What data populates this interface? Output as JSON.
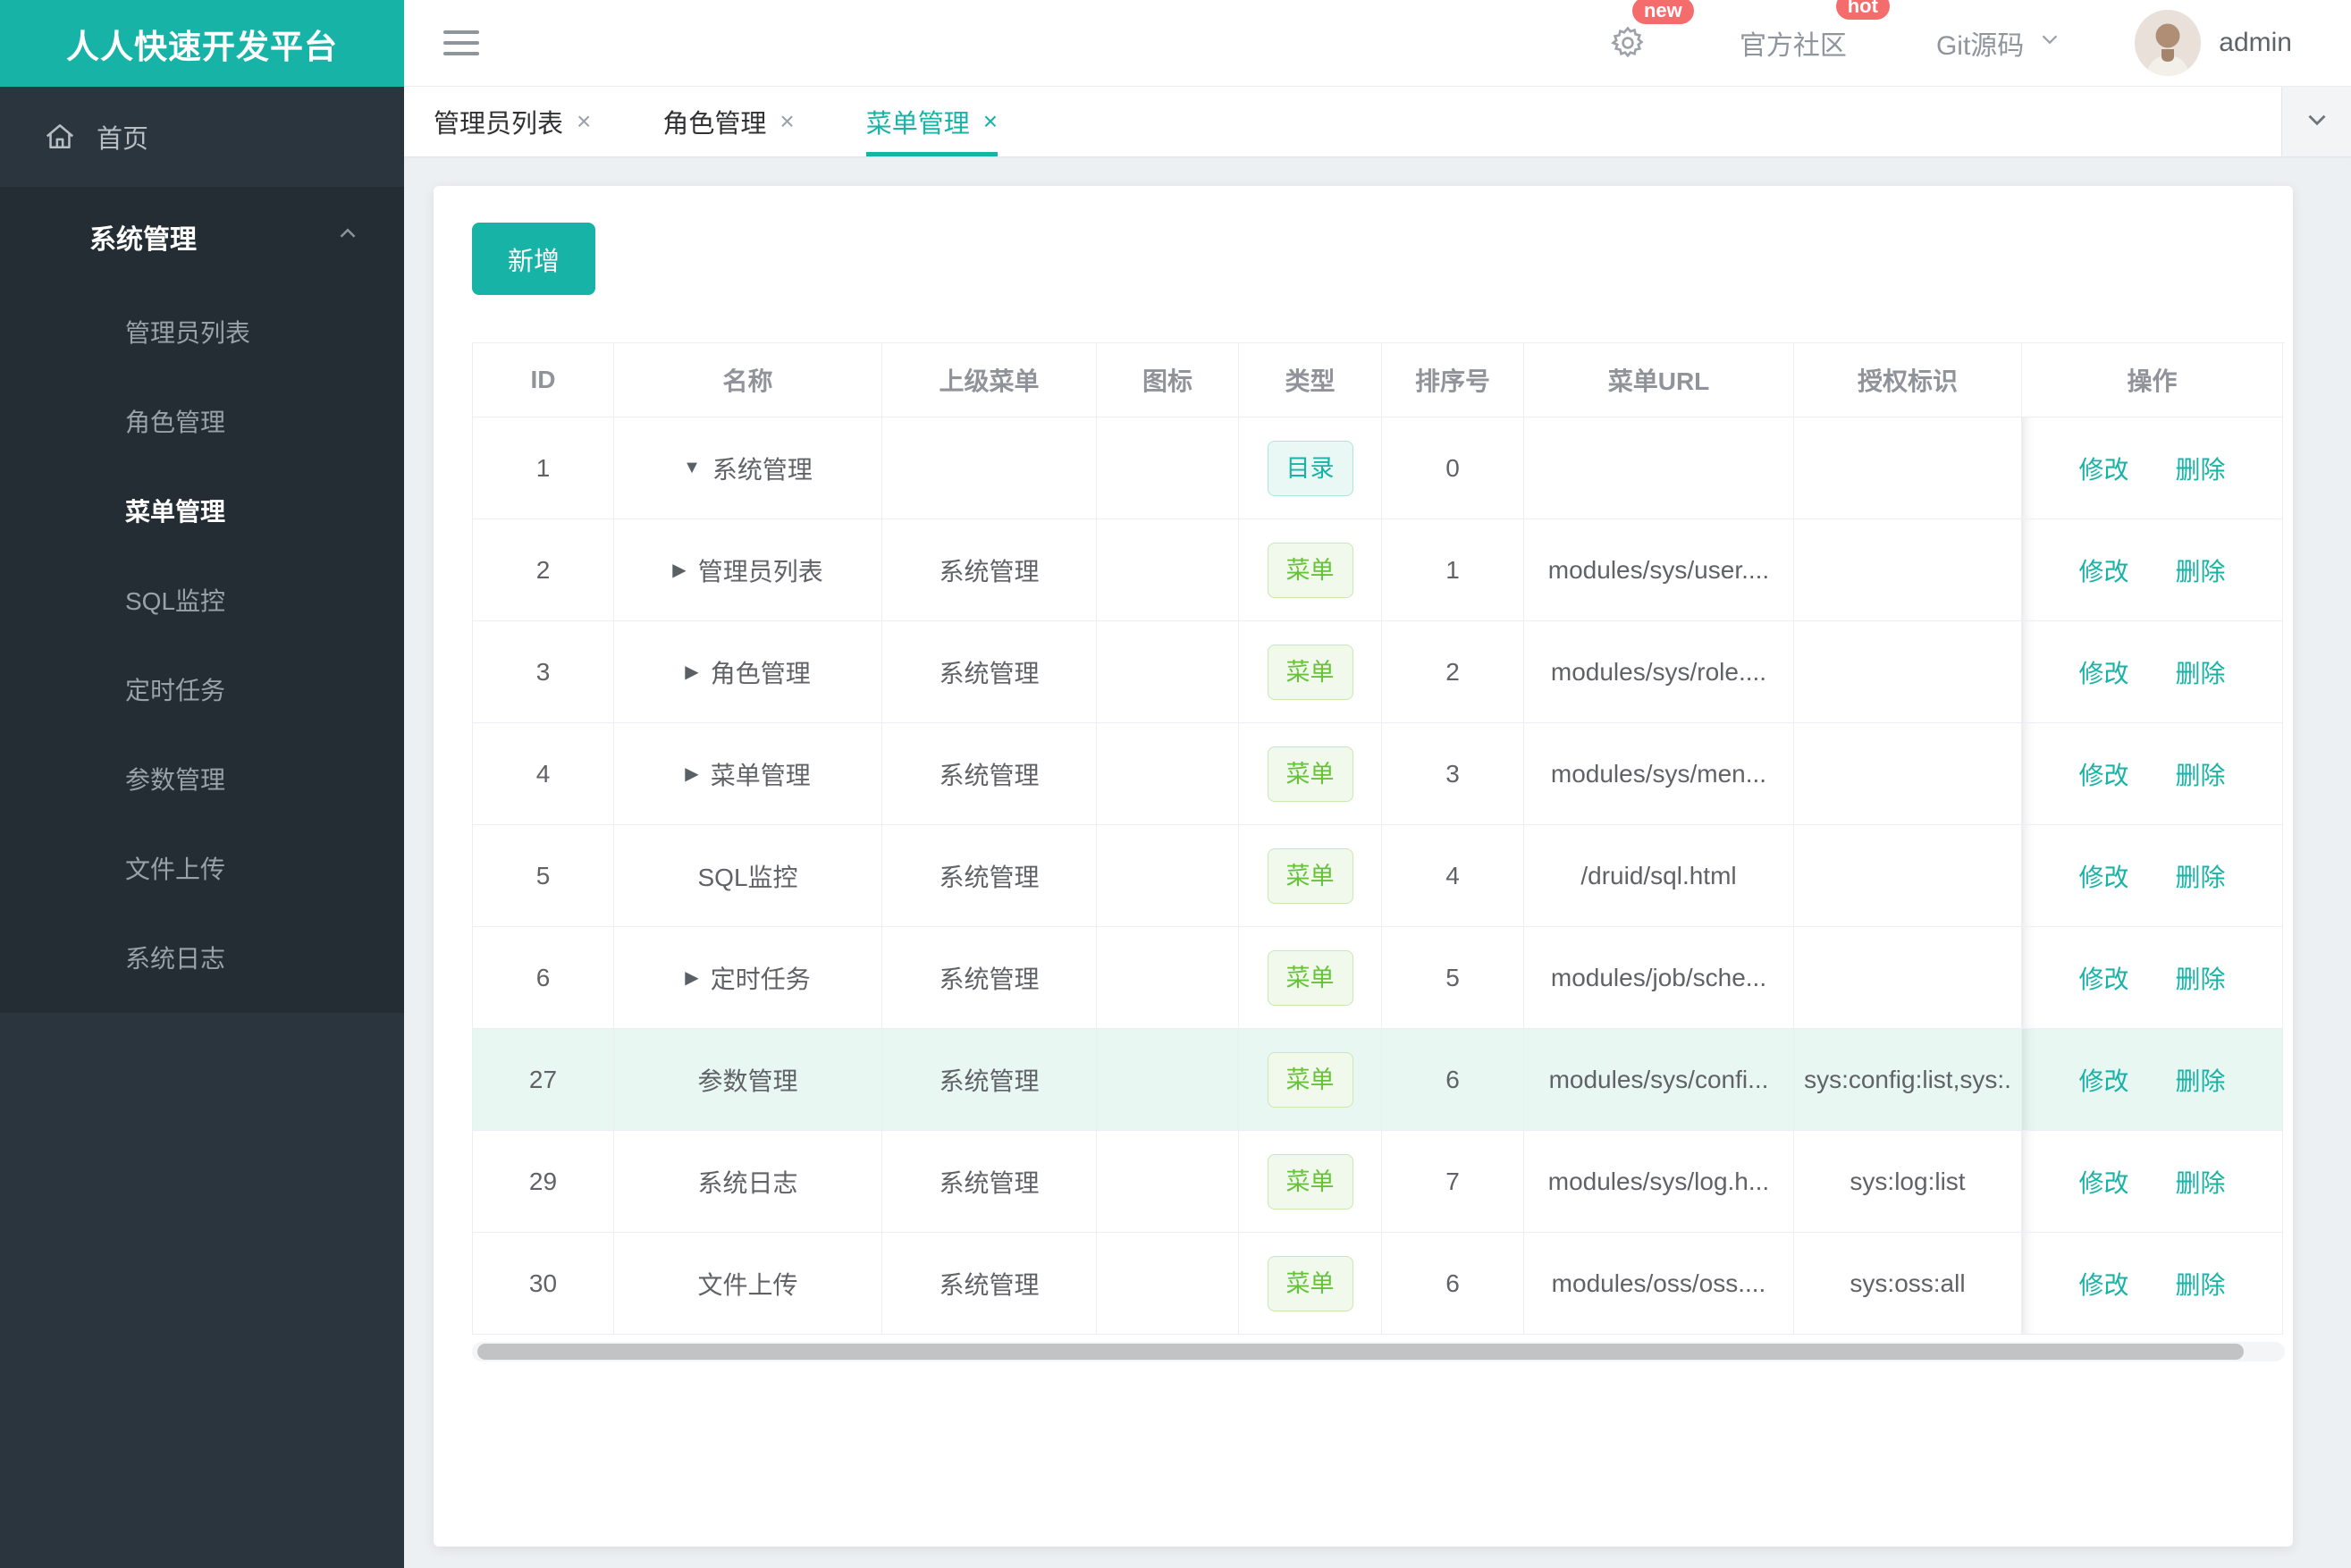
{
  "brand": {
    "title": "人人快速开发平台"
  },
  "colors": {
    "accent": "#17b3a6",
    "danger": "#f56c6c",
    "success": "#67c23a",
    "sidebar_bg": "#2b353e",
    "sidebar_open_bg": "#232d33",
    "row_highlight": "#e9f7f3"
  },
  "topbar": {
    "settings_badge": "new",
    "community": {
      "label": "官方社区",
      "badge": "hot"
    },
    "git": {
      "label": "Git源码"
    },
    "user": {
      "name": "admin"
    }
  },
  "tabs": [
    {
      "label": "管理员列表",
      "close": "×",
      "active": false
    },
    {
      "label": "角色管理",
      "close": "×",
      "active": false
    },
    {
      "label": "菜单管理",
      "close": "×",
      "active": true
    }
  ],
  "sidebar": {
    "home": {
      "label": "首页"
    },
    "submenu": {
      "title": "系统管理",
      "expanded": true,
      "items": [
        {
          "label": "管理员列表",
          "active": false
        },
        {
          "label": "角色管理",
          "active": false
        },
        {
          "label": "菜单管理",
          "active": true
        },
        {
          "label": "SQL监控",
          "active": false
        },
        {
          "label": "定时任务",
          "active": false
        },
        {
          "label": "参数管理",
          "active": false
        },
        {
          "label": "文件上传",
          "active": false
        },
        {
          "label": "系统日志",
          "active": false
        }
      ]
    }
  },
  "toolbar": {
    "add_label": "新增"
  },
  "table": {
    "headers": [
      "ID",
      "名称",
      "上级菜单",
      "图标",
      "类型",
      "排序号",
      "菜单URL",
      "授权标识",
      "操作"
    ],
    "actions": {
      "edit": "修改",
      "delete": "删除"
    },
    "rows": [
      {
        "id": "1",
        "arrow": "down",
        "name": "系统管理",
        "parent": "",
        "icon": "",
        "type": "目录",
        "order": "0",
        "url": "",
        "perm": "",
        "highlighted": false
      },
      {
        "id": "2",
        "arrow": "right",
        "name": "管理员列表",
        "parent": "系统管理",
        "icon": "",
        "type": "菜单",
        "order": "1",
        "url": "modules/sys/user....",
        "perm": "",
        "highlighted": false
      },
      {
        "id": "3",
        "arrow": "right",
        "name": "角色管理",
        "parent": "系统管理",
        "icon": "",
        "type": "菜单",
        "order": "2",
        "url": "modules/sys/role....",
        "perm": "",
        "highlighted": false
      },
      {
        "id": "4",
        "arrow": "right",
        "name": "菜单管理",
        "parent": "系统管理",
        "icon": "",
        "type": "菜单",
        "order": "3",
        "url": "modules/sys/men...",
        "perm": "",
        "highlighted": false
      },
      {
        "id": "5",
        "arrow": "",
        "name": "SQL监控",
        "parent": "系统管理",
        "icon": "",
        "type": "菜单",
        "order": "4",
        "url": "/druid/sql.html",
        "perm": "",
        "highlighted": false
      },
      {
        "id": "6",
        "arrow": "right",
        "name": "定时任务",
        "parent": "系统管理",
        "icon": "",
        "type": "菜单",
        "order": "5",
        "url": "modules/job/sche...",
        "perm": "",
        "highlighted": false
      },
      {
        "id": "27",
        "arrow": "",
        "name": "参数管理",
        "parent": "系统管理",
        "icon": "",
        "type": "菜单",
        "order": "6",
        "url": "modules/sys/confi...",
        "perm": "sys:config:list,sys:.",
        "highlighted": true
      },
      {
        "id": "29",
        "arrow": "",
        "name": "系统日志",
        "parent": "系统管理",
        "icon": "",
        "type": "菜单",
        "order": "7",
        "url": "modules/sys/log.h...",
        "perm": "sys:log:list",
        "highlighted": false
      },
      {
        "id": "30",
        "arrow": "",
        "name": "文件上传",
        "parent": "系统管理",
        "icon": "",
        "type": "菜单",
        "order": "6",
        "url": "modules/oss/oss....",
        "perm": "sys:oss:all",
        "highlighted": false
      }
    ]
  }
}
